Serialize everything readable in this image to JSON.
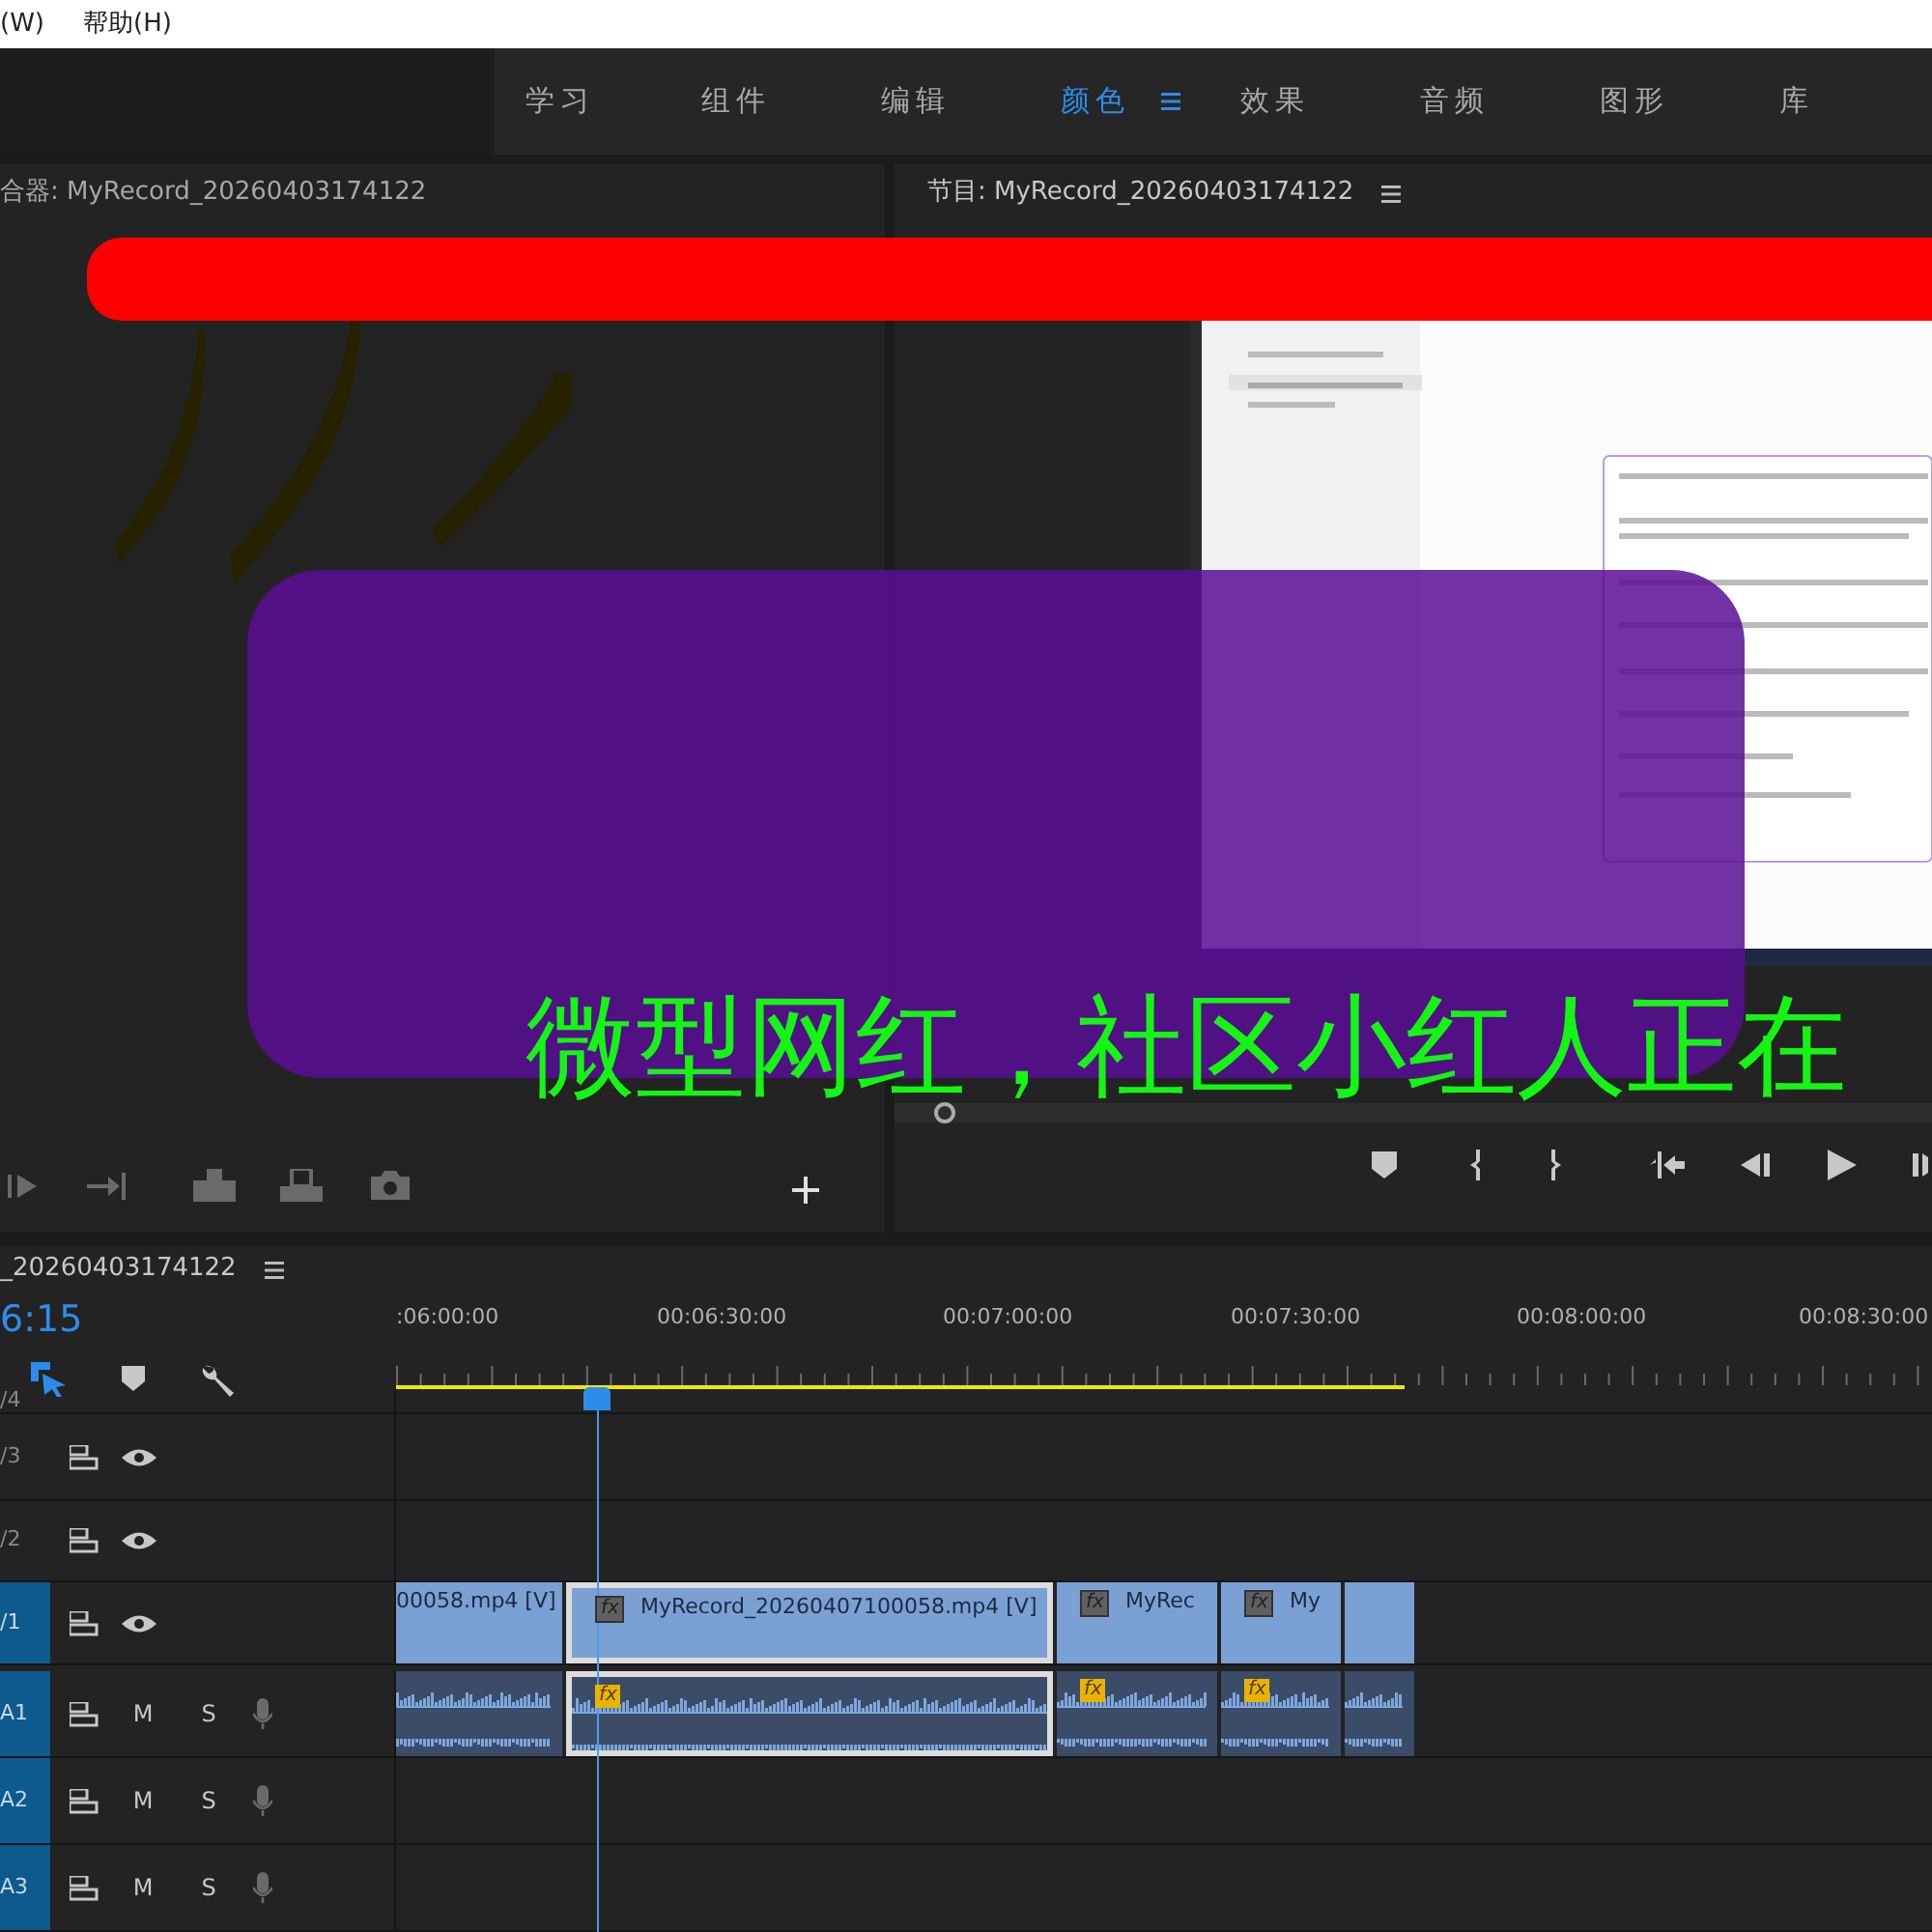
{
  "menu": [
    {
      "label": "(W)"
    },
    {
      "label": "帮助(H)"
    }
  ],
  "workspace_tabs": [
    {
      "label": "学习",
      "selected": false
    },
    {
      "label": "组件",
      "selected": false
    },
    {
      "label": "编辑",
      "selected": false
    },
    {
      "label": "颜色",
      "selected": true
    },
    {
      "label": "效果",
      "selected": false
    },
    {
      "label": "音频",
      "selected": false
    },
    {
      "label": "图形",
      "selected": false
    },
    {
      "label": "库",
      "selected": false
    }
  ],
  "source_monitor": {
    "title": "合器: MyRecord_20260403174122"
  },
  "program_monitor": {
    "title": "节目: MyRecord_20260403174122"
  },
  "overlay": {
    "subtitle": "微型网红，社区小红人正在"
  },
  "timeline": {
    "title": "_20260403174122",
    "timecode": "6:15",
    "ruler_labels": [
      ":06:00:00",
      "00:06:30:00",
      "00:07:00:00",
      "00:07:30:00",
      "00:08:00:00",
      "00:08:30:00"
    ],
    "tracks": [
      {
        "kind": "video",
        "label": "/4",
        "targeted": false
      },
      {
        "kind": "video",
        "label": "/3",
        "targeted": false
      },
      {
        "kind": "video",
        "label": "/2",
        "targeted": false
      },
      {
        "kind": "video",
        "label": "/1",
        "targeted": true,
        "clips": [
          {
            "name": "00058.mp4 [V]",
            "selected": false
          },
          {
            "name": "MyRecord_20260407100058.mp4 [V]",
            "selected": true,
            "badge": "fx"
          },
          {
            "name": "MyRec",
            "selected": false,
            "badge": "fx"
          },
          {
            "name": "My",
            "selected": false,
            "badge": "fx"
          },
          {
            "selected": false
          }
        ]
      },
      {
        "kind": "audio",
        "label": "A1",
        "targeted": true,
        "mute": "M",
        "solo": "S",
        "clips": [
          {
            "selected": false
          },
          {
            "selected": true,
            "badge": "fx"
          },
          {
            "selected": false,
            "badge": "fx"
          },
          {
            "selected": false,
            "badge": "fx"
          },
          {
            "selected": false
          }
        ]
      },
      {
        "kind": "audio",
        "label": "A2",
        "targeted": true,
        "mute": "M",
        "solo": "S"
      },
      {
        "kind": "audio",
        "label": "A3",
        "targeted": true,
        "mute": "M",
        "solo": "S"
      }
    ]
  }
}
